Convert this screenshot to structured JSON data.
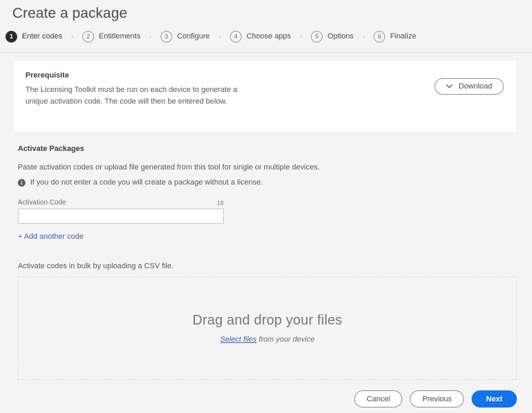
{
  "header": {
    "title": "Create a package"
  },
  "stepper": {
    "separator": "›",
    "steps": [
      {
        "number": "1",
        "label": "Enter codes",
        "active": true
      },
      {
        "number": "2",
        "label": "Entitlements",
        "active": false
      },
      {
        "number": "3",
        "label": "Configure",
        "active": false
      },
      {
        "number": "4",
        "label": "Choose apps",
        "active": false
      },
      {
        "number": "5",
        "label": "Options",
        "active": false
      },
      {
        "number": "6",
        "label": "Finalize",
        "active": false
      }
    ]
  },
  "prerequisite": {
    "title": "Prerequisite",
    "body": "The Licensing Toolkit must be run on each device to generate a unique activation code. The code will then be entered below.",
    "download_label": "Download",
    "download_icon": "chevron-down-icon"
  },
  "activate": {
    "title": "Activate Packages",
    "description": "Paste activation codes or upload file generated from this tool for single or multiple devices.",
    "note_icon": "info-icon",
    "note": "If you do not enter a code you will create a package without a license.",
    "field": {
      "label": "Activation Code",
      "counter": "18",
      "value": "",
      "placeholder": ""
    },
    "add_another_label": "+ Add another code"
  },
  "bulk": {
    "label": "Activate codes in bulk by uploading a CSV file.",
    "dropzone_title": "Drag and drop your files",
    "dropzone_link": "Select files",
    "dropzone_suffix": " from your device"
  },
  "footer": {
    "cancel_label": "Cancel",
    "previous_label": "Previous",
    "next_label": "Next"
  },
  "colors": {
    "accent": "#1473e6",
    "link": "#3d64a8",
    "active_step": "#2c2c2c",
    "page_background": "#f4f4f4",
    "card_background": "#ffffff"
  }
}
